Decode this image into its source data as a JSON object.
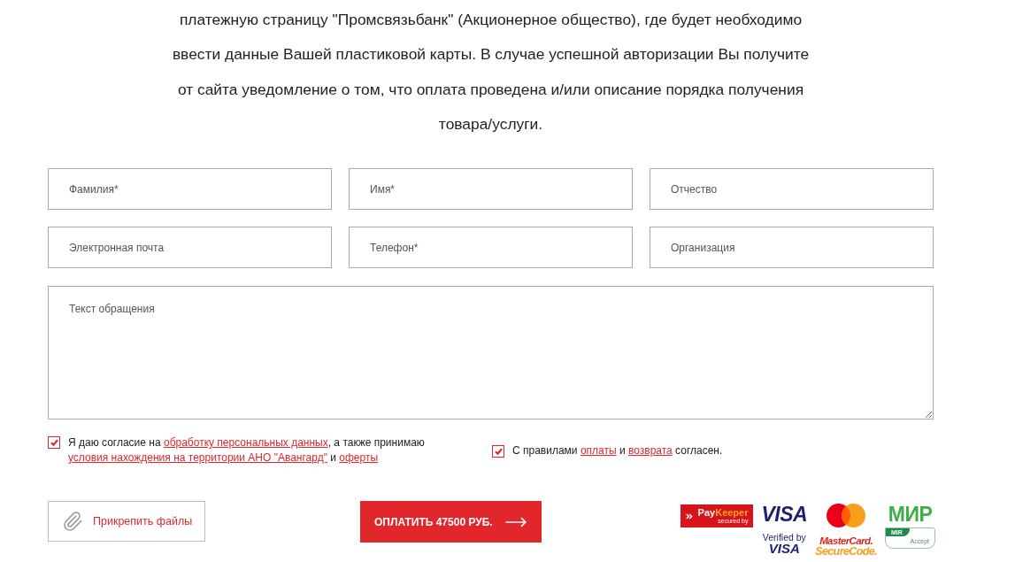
{
  "intro": "платежную страницу \"Промсвязьбанк\" (Акционерное общество), где будет необходимо ввести данные Вашей пластиковой карты. В случае успешной авторизации Вы получите от сайта уведомление о том, что оплата проведена и/или описание порядка получения товара/услуги.",
  "form": {
    "fields": [
      {
        "placeholder": "Фамилия*"
      },
      {
        "placeholder": "Имя*"
      },
      {
        "placeholder": "Отчество"
      },
      {
        "placeholder": "Электронная почта"
      },
      {
        "placeholder": "Телефон*"
      },
      {
        "placeholder": "Организация"
      }
    ],
    "message": {
      "placeholder": "Текст обращения"
    },
    "consents": [
      {
        "checked": true,
        "parts": [
          {
            "kind": "text",
            "text": "Я даю согласие на "
          },
          {
            "kind": "link",
            "text": "обработку персональных данных"
          },
          {
            "kind": "text",
            "text": ", а также принимаю "
          },
          {
            "kind": "link",
            "text": "условия нахождения на территории АНО \"Авангард\""
          },
          {
            "kind": "text",
            "text": " и "
          },
          {
            "kind": "link",
            "text": "оферты"
          }
        ]
      },
      {
        "checked": true,
        "parts": [
          {
            "kind": "text",
            "text": "С правилами "
          },
          {
            "kind": "link",
            "text": "оплаты"
          },
          {
            "kind": "text",
            "text": " и "
          },
          {
            "kind": "link",
            "text": "возврата"
          },
          {
            "kind": "text",
            "text": " согласен."
          }
        ]
      }
    ],
    "attach_button": "Прикрепить файлы",
    "pay_button": "ОПЛАТИТЬ 47500 РУБ."
  },
  "payment_logos": [
    {
      "kind": "paykeeper",
      "wordmark": [
        "Pay",
        "Keeper"
      ],
      "tagline": "secured by"
    },
    {
      "kind": "visa",
      "mark": "VISA",
      "caption": [
        "Verified by",
        "VISA"
      ]
    },
    {
      "kind": "mastercard",
      "caption": [
        "MasterCard.",
        "SecureCode."
      ]
    },
    {
      "kind": "mir",
      "mark": "МИР",
      "badge": "MIR",
      "caption": "Accept"
    }
  ]
}
